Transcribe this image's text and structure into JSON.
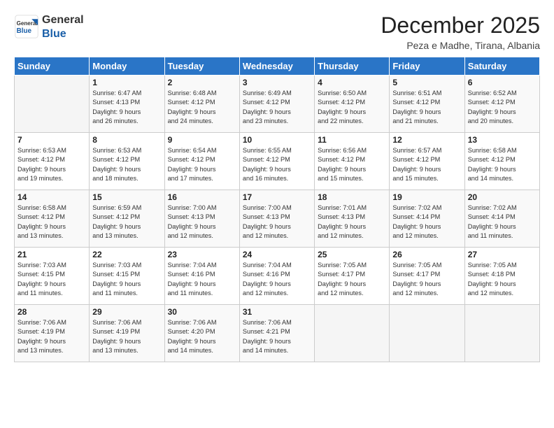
{
  "header": {
    "logo_general": "General",
    "logo_blue": "Blue",
    "month_title": "December 2025",
    "subtitle": "Peza e Madhe, Tirana, Albania"
  },
  "days_of_week": [
    "Sunday",
    "Monday",
    "Tuesday",
    "Wednesday",
    "Thursday",
    "Friday",
    "Saturday"
  ],
  "weeks": [
    [
      {
        "day": "",
        "info": ""
      },
      {
        "day": "1",
        "info": "Sunrise: 6:47 AM\nSunset: 4:13 PM\nDaylight: 9 hours\nand 26 minutes."
      },
      {
        "day": "2",
        "info": "Sunrise: 6:48 AM\nSunset: 4:12 PM\nDaylight: 9 hours\nand 24 minutes."
      },
      {
        "day": "3",
        "info": "Sunrise: 6:49 AM\nSunset: 4:12 PM\nDaylight: 9 hours\nand 23 minutes."
      },
      {
        "day": "4",
        "info": "Sunrise: 6:50 AM\nSunset: 4:12 PM\nDaylight: 9 hours\nand 22 minutes."
      },
      {
        "day": "5",
        "info": "Sunrise: 6:51 AM\nSunset: 4:12 PM\nDaylight: 9 hours\nand 21 minutes."
      },
      {
        "day": "6",
        "info": "Sunrise: 6:52 AM\nSunset: 4:12 PM\nDaylight: 9 hours\nand 20 minutes."
      }
    ],
    [
      {
        "day": "7",
        "info": "Sunrise: 6:53 AM\nSunset: 4:12 PM\nDaylight: 9 hours\nand 19 minutes."
      },
      {
        "day": "8",
        "info": "Sunrise: 6:53 AM\nSunset: 4:12 PM\nDaylight: 9 hours\nand 18 minutes."
      },
      {
        "day": "9",
        "info": "Sunrise: 6:54 AM\nSunset: 4:12 PM\nDaylight: 9 hours\nand 17 minutes."
      },
      {
        "day": "10",
        "info": "Sunrise: 6:55 AM\nSunset: 4:12 PM\nDaylight: 9 hours\nand 16 minutes."
      },
      {
        "day": "11",
        "info": "Sunrise: 6:56 AM\nSunset: 4:12 PM\nDaylight: 9 hours\nand 15 minutes."
      },
      {
        "day": "12",
        "info": "Sunrise: 6:57 AM\nSunset: 4:12 PM\nDaylight: 9 hours\nand 15 minutes."
      },
      {
        "day": "13",
        "info": "Sunrise: 6:58 AM\nSunset: 4:12 PM\nDaylight: 9 hours\nand 14 minutes."
      }
    ],
    [
      {
        "day": "14",
        "info": "Sunrise: 6:58 AM\nSunset: 4:12 PM\nDaylight: 9 hours\nand 13 minutes."
      },
      {
        "day": "15",
        "info": "Sunrise: 6:59 AM\nSunset: 4:12 PM\nDaylight: 9 hours\nand 13 minutes."
      },
      {
        "day": "16",
        "info": "Sunrise: 7:00 AM\nSunset: 4:13 PM\nDaylight: 9 hours\nand 12 minutes."
      },
      {
        "day": "17",
        "info": "Sunrise: 7:00 AM\nSunset: 4:13 PM\nDaylight: 9 hours\nand 12 minutes."
      },
      {
        "day": "18",
        "info": "Sunrise: 7:01 AM\nSunset: 4:13 PM\nDaylight: 9 hours\nand 12 minutes."
      },
      {
        "day": "19",
        "info": "Sunrise: 7:02 AM\nSunset: 4:14 PM\nDaylight: 9 hours\nand 12 minutes."
      },
      {
        "day": "20",
        "info": "Sunrise: 7:02 AM\nSunset: 4:14 PM\nDaylight: 9 hours\nand 11 minutes."
      }
    ],
    [
      {
        "day": "21",
        "info": "Sunrise: 7:03 AM\nSunset: 4:15 PM\nDaylight: 9 hours\nand 11 minutes."
      },
      {
        "day": "22",
        "info": "Sunrise: 7:03 AM\nSunset: 4:15 PM\nDaylight: 9 hours\nand 11 minutes."
      },
      {
        "day": "23",
        "info": "Sunrise: 7:04 AM\nSunset: 4:16 PM\nDaylight: 9 hours\nand 11 minutes."
      },
      {
        "day": "24",
        "info": "Sunrise: 7:04 AM\nSunset: 4:16 PM\nDaylight: 9 hours\nand 12 minutes."
      },
      {
        "day": "25",
        "info": "Sunrise: 7:05 AM\nSunset: 4:17 PM\nDaylight: 9 hours\nand 12 minutes."
      },
      {
        "day": "26",
        "info": "Sunrise: 7:05 AM\nSunset: 4:17 PM\nDaylight: 9 hours\nand 12 minutes."
      },
      {
        "day": "27",
        "info": "Sunrise: 7:05 AM\nSunset: 4:18 PM\nDaylight: 9 hours\nand 12 minutes."
      }
    ],
    [
      {
        "day": "28",
        "info": "Sunrise: 7:06 AM\nSunset: 4:19 PM\nDaylight: 9 hours\nand 13 minutes."
      },
      {
        "day": "29",
        "info": "Sunrise: 7:06 AM\nSunset: 4:19 PM\nDaylight: 9 hours\nand 13 minutes."
      },
      {
        "day": "30",
        "info": "Sunrise: 7:06 AM\nSunset: 4:20 PM\nDaylight: 9 hours\nand 14 minutes."
      },
      {
        "day": "31",
        "info": "Sunrise: 7:06 AM\nSunset: 4:21 PM\nDaylight: 9 hours\nand 14 minutes."
      },
      {
        "day": "",
        "info": ""
      },
      {
        "day": "",
        "info": ""
      },
      {
        "day": "",
        "info": ""
      }
    ]
  ]
}
